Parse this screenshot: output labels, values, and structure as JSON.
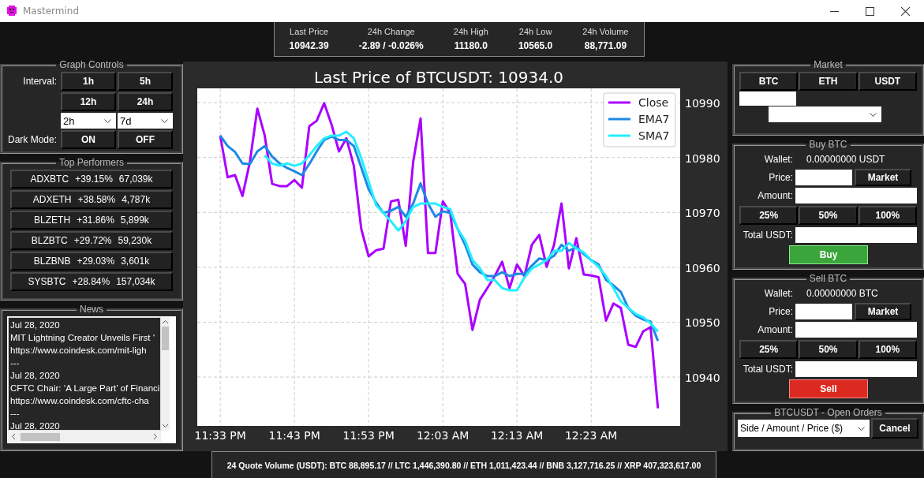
{
  "window": {
    "title": "Mastermind"
  },
  "stats": [
    {
      "label": "Last Price",
      "value": "10942.39"
    },
    {
      "label": "24h Change",
      "value": "-2.89 / -0.026%"
    },
    {
      "label": "24h High",
      "value": "11180.0"
    },
    {
      "label": "24h Low",
      "value": "10565.0"
    },
    {
      "label": "24h Volume",
      "value": "88,771.09"
    }
  ],
  "graph_controls": {
    "title": "Graph Controls",
    "interval_label": "Interval:",
    "interval_buttons": [
      "1h",
      "5h",
      "12h",
      "24h"
    ],
    "selects": [
      {
        "value": "2h"
      },
      {
        "value": "7d"
      }
    ],
    "dark_mode_label": "Dark Mode:",
    "dark_mode_buttons": [
      "ON",
      "OFF"
    ]
  },
  "top_performers": {
    "title": "Top Performers",
    "items": [
      {
        "symbol": "ADXBTC",
        "change": "+39.15%",
        "volume": "67,039k"
      },
      {
        "symbol": "ADXETH",
        "change": "+38.58%",
        "volume": "4,787k"
      },
      {
        "symbol": "BLZETH",
        "change": "+31.86%",
        "volume": "5,899k"
      },
      {
        "symbol": "BLZBTC",
        "change": "+29.72%",
        "volume": "59,230k"
      },
      {
        "symbol": "BLZBNB",
        "change": "+29.03%",
        "volume": "3,601k"
      },
      {
        "symbol": "SYSBTC",
        "change": "+28.84%",
        "volume": "157,034k"
      }
    ]
  },
  "news": {
    "title": "News",
    "lines": [
      "Jul 28, 2020",
      "MIT Lightning Creator Unveils First ‘",
      "https://www.coindesk.com/mit-ligh",
      "---",
      "Jul 28, 2020",
      "CFTC Chair: ‘A Large Part’ of Financi",
      "https://www.coindesk.com/cftc-cha",
      "---",
      "Jul 28, 2020"
    ]
  },
  "chart": {
    "chart_data": {
      "type": "line",
      "title": "Last Price of BTCUSDT: 10934.0",
      "categories": [
        "11:33 PM",
        null,
        null,
        null,
        null,
        null,
        null,
        null,
        null,
        null,
        "11:43 PM",
        null,
        null,
        null,
        null,
        null,
        null,
        null,
        null,
        null,
        "11:53 PM",
        null,
        null,
        null,
        null,
        null,
        null,
        null,
        null,
        null,
        "12:03 AM",
        null,
        null,
        null,
        null,
        null,
        null,
        null,
        null,
        null,
        "12:13 AM",
        null,
        null,
        null,
        null,
        null,
        null,
        null,
        null,
        null,
        "12:23 AM",
        null,
        null,
        null,
        null,
        null,
        null,
        null,
        null,
        null
      ],
      "series": [
        {
          "name": "Close",
          "color": "#aa00ff",
          "values": [
            10984.0,
            10976.4,
            10976.8,
            10973.0,
            10979.2,
            10988.9,
            10984.0,
            10975.2,
            10974.8,
            10974.8,
            10975.9,
            10974.5,
            10985.7,
            10986.7,
            10989.9,
            10986.0,
            10981.1,
            10983.5,
            10978.5,
            10967.0,
            10962.0,
            10963.1,
            10963.4,
            10972.0,
            10972.3,
            10963.9,
            10979.2,
            10987.1,
            10962.6,
            10962.6,
            10972.0,
            10969.9,
            10958.8,
            10957.0,
            10948.6,
            10954.1,
            10956.2,
            10958.4,
            10961.0,
            10956.2,
            10960.5,
            10958.4,
            10964.1,
            10965.9,
            10960.1,
            10964.1,
            10971.6,
            10959.8,
            10965.3,
            10958.7,
            10958.5,
            10958.2,
            10950.3,
            10953.4,
            10952.6,
            10945.9,
            10945.5,
            10948.3,
            10949.1,
            10934.3
          ]
        },
        {
          "name": "EMA7",
          "color": "#1e88e5",
          "values": [
            10984.0,
            10982.1,
            10981.0,
            10978.9,
            10978.8,
            10981.1,
            10982.1,
            10980.2,
            10978.9,
            10978.1,
            10977.5,
            10976.8,
            10978.8,
            10981.1,
            10983.2,
            10983.8,
            10983.2,
            10983.2,
            10982.1,
            10978.2,
            10974.2,
            10971.8,
            10969.9,
            10970.3,
            10971.0,
            10969.2,
            10971.6,
            10975.3,
            10971.6,
            10969.2,
            10970.2,
            10969.9,
            10967.0,
            10964.1,
            10960.5,
            10959.1,
            10958.4,
            10958.4,
            10959.1,
            10958.4,
            10958.8,
            10958.8,
            10960.3,
            10961.6,
            10961.3,
            10962.1,
            10964.1,
            10963.0,
            10963.7,
            10962.4,
            10961.3,
            10960.5,
            10957.7,
            10956.7,
            10955.5,
            10952.6,
            10951.2,
            10950.5,
            10950.1,
            10946.6
          ]
        },
        {
          "name": "SMA7",
          "color": "#22eeff",
          "values": [
            null,
            null,
            null,
            null,
            null,
            null,
            10980.4,
            10978.9,
            10978.5,
            10978.9,
            10978.5,
            10978.9,
            10980.4,
            10982.1,
            10983.5,
            10984.0,
            10984.0,
            10984.7,
            10983.5,
            10979.9,
            10975.6,
            10971.3,
            10969.9,
            10968.4,
            10966.7,
            10968.4,
            10971.0,
            10971.6,
            10971.6,
            10971.6,
            10971.0,
            10970.6,
            10967.0,
            10964.9,
            10961.3,
            10959.8,
            10957.7,
            10957.7,
            10956.2,
            10955.8,
            10955.8,
            10958.1,
            10959.8,
            10960.5,
            10961.3,
            10963.0,
            10963.0,
            10964.4,
            10963.4,
            10962.7,
            10961.3,
            10960.1,
            10958.4,
            10956.2,
            10953.8,
            10952.6,
            10951.5,
            10950.9,
            10949.8,
            10948.3
          ]
        }
      ],
      "ylim": [
        10931.1,
        10992.6
      ],
      "grid": true,
      "legend": true,
      "yticks": [
        10940,
        10950,
        10960,
        10970,
        10980,
        10990
      ]
    }
  },
  "market": {
    "title": "Market",
    "buttons": [
      "BTC",
      "ETH",
      "USDT"
    ]
  },
  "trade_panels": [
    {
      "kind": "buy",
      "title": "Buy BTC",
      "wallet_label": "Wallet:",
      "wallet_value": "0.00000000 USDT",
      "price_label": "Price:",
      "market_button": "Market",
      "amount_label": "Amount:",
      "percent_buttons": [
        "25%",
        "50%",
        "100%"
      ],
      "total_label": "Total USDT:",
      "action_button": "Buy"
    },
    {
      "kind": "sell",
      "title": "Sell BTC",
      "wallet_label": "Wallet:",
      "wallet_value": "0.00000000 BTC",
      "price_label": "Price:",
      "market_button": "Market",
      "amount_label": "Amount:",
      "percent_buttons": [
        "25%",
        "50%",
        "100%"
      ],
      "total_label": "Total USDT:",
      "action_button": "Sell"
    }
  ],
  "open_orders": {
    "title": "BTCUSDT - Open Orders",
    "select_value": "Side / Amount / Price ($)",
    "cancel_button": "Cancel"
  },
  "status_bar": {
    "text": "24 Quote Volume (USDT): BTC 88,895.17 // LTC 1,446,390.80 // ETH 1,011,423.44 // BNB 3,127,716.25 // XRP 407,323,617.00"
  }
}
